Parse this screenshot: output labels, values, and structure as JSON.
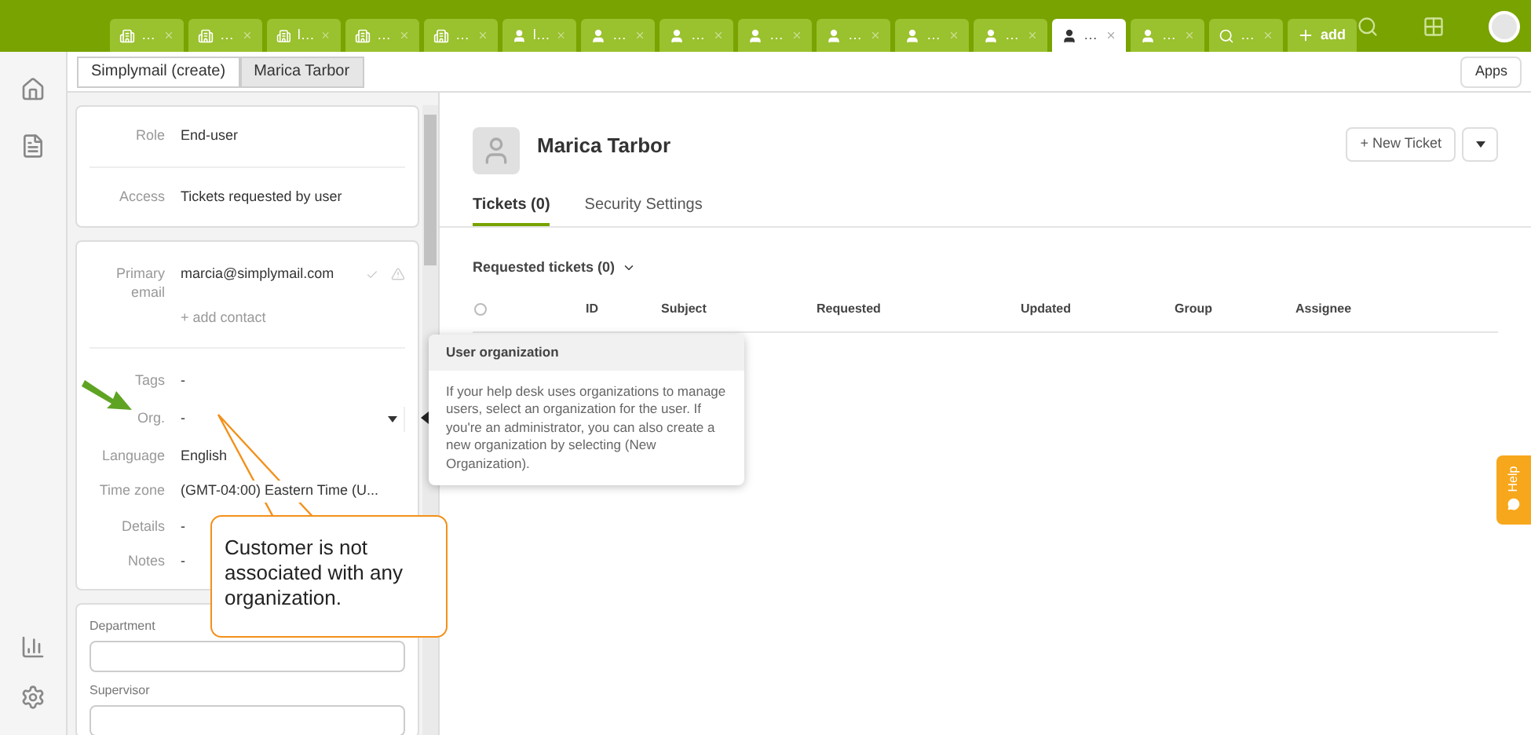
{
  "top_tabs": [
    {
      "kind": "organization",
      "label": "…",
      "selected": false
    },
    {
      "kind": "organization",
      "label": "…",
      "selected": false
    },
    {
      "kind": "organization",
      "label": "l…",
      "selected": false
    },
    {
      "kind": "organization",
      "label": "…",
      "selected": false
    },
    {
      "kind": "organization",
      "label": "…",
      "selected": false
    },
    {
      "kind": "user",
      "label": "l…",
      "selected": false
    },
    {
      "kind": "user",
      "label": "…",
      "selected": false
    },
    {
      "kind": "user",
      "label": "…",
      "selected": false
    },
    {
      "kind": "user",
      "label": "…",
      "selected": false
    },
    {
      "kind": "user",
      "label": "…",
      "selected": false
    },
    {
      "kind": "user",
      "label": "…",
      "selected": false
    },
    {
      "kind": "user",
      "label": "…",
      "selected": false
    },
    {
      "kind": "user",
      "label": "…",
      "selected": true
    },
    {
      "kind": "user",
      "label": "…",
      "selected": false
    },
    {
      "kind": "search",
      "label": "…",
      "selected": false
    },
    {
      "kind": "add",
      "label": "add",
      "selected": false
    }
  ],
  "sub_tabs": [
    {
      "label": "Simplymail (create)",
      "selected": false
    },
    {
      "label": "Marica Tarbor",
      "selected": true
    }
  ],
  "apps_button": "Apps",
  "user_card": [
    {
      "label": "Role",
      "value": "End-user"
    },
    {
      "label": "Access",
      "value": "Tickets requested by user"
    }
  ],
  "contact": {
    "label": "Primary email",
    "value": "marcia@simplymail.com",
    "add": "+ add contact"
  },
  "properties": [
    {
      "label": "Tags",
      "value": "-",
      "kind": "text"
    },
    {
      "label": "Org.",
      "value": "-",
      "kind": "select"
    },
    {
      "label": "Language",
      "value": "English",
      "kind": "text"
    },
    {
      "label": "Time zone",
      "value": "(GMT-04:00) Eastern Time (U...",
      "kind": "text"
    },
    {
      "label": "Details",
      "value": "-",
      "kind": "text"
    },
    {
      "label": "Notes",
      "value": "-",
      "kind": "text"
    }
  ],
  "custom_fields": [
    {
      "label": "Department"
    },
    {
      "label": "Supervisor"
    }
  ],
  "profile": {
    "name": "Marica Tarbor",
    "new_ticket": "+ New Ticket"
  },
  "profile_tabs": [
    {
      "label": "Tickets (0)",
      "selected": true
    },
    {
      "label": "Security Settings",
      "selected": false
    }
  ],
  "tickets": {
    "heading": "Requested tickets (0)",
    "select_all_checked": false,
    "columns": [
      "ID",
      "Subject",
      "Requested",
      "Updated",
      "Group",
      "Assignee"
    ]
  },
  "tooltip": {
    "title": "User organization",
    "body": "If your help desk uses organizations to manage users, select an organization for the user. If you're an administrator, you can also create a new organization by selecting (New Organization)."
  },
  "callout": "Customer is not associated with any organization.",
  "help_tab": "Help"
}
